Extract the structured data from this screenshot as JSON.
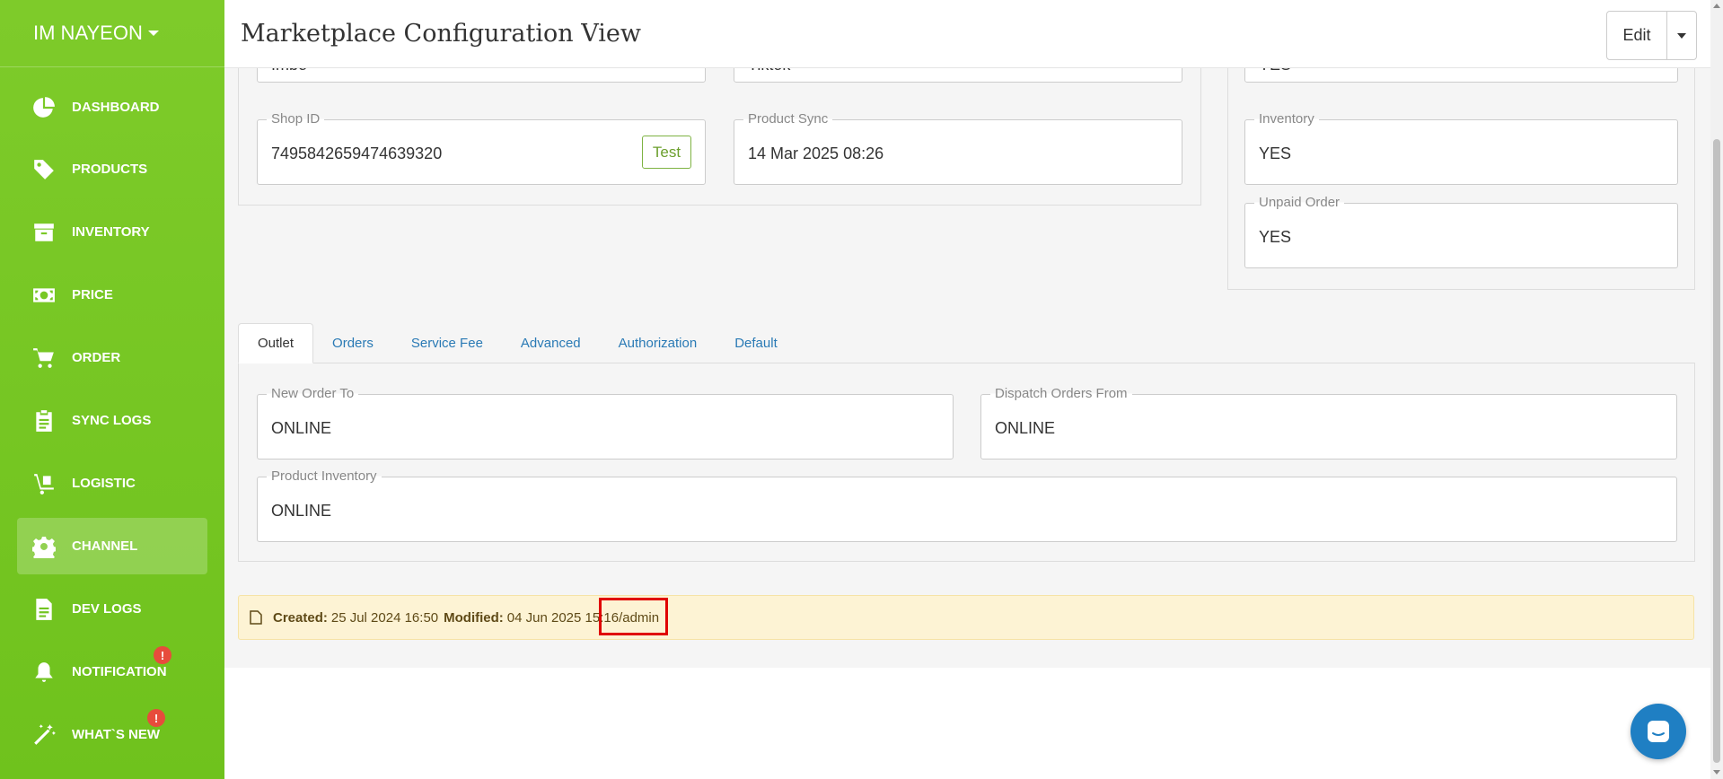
{
  "sidebar": {
    "brand": "IM NAYEON",
    "items": [
      {
        "label": "DASHBOARD",
        "icon": "pie-chart-icon"
      },
      {
        "label": "PRODUCTS",
        "icon": "tag-icon"
      },
      {
        "label": "INVENTORY",
        "icon": "archive-icon"
      },
      {
        "label": "PRICE",
        "icon": "money-icon"
      },
      {
        "label": "ORDER",
        "icon": "cart-icon"
      },
      {
        "label": "SYNC LOGS",
        "icon": "clipboard-icon"
      },
      {
        "label": "LOGISTIC",
        "icon": "dolly-icon"
      },
      {
        "label": "CHANNEL",
        "icon": "gear-icon",
        "active": true
      },
      {
        "label": "DEV LOGS",
        "icon": "file-icon"
      },
      {
        "label": "NOTIFICATION",
        "icon": "bell-icon",
        "badge": "!"
      },
      {
        "label": "WHAT`S NEW",
        "icon": "magic-wand-icon",
        "badge": "!"
      }
    ]
  },
  "header": {
    "title": "Marketplace Configuration View",
    "edit_label": "Edit"
  },
  "top_fields": {
    "name_clipped": "Imbe",
    "marketplace_clipped": "Tiktok",
    "right_clipped": "YES",
    "shop_id": {
      "label": "Shop ID",
      "value": "7495842659474639320",
      "button": "Test"
    },
    "product_sync": {
      "label": "Product Sync",
      "value": "14 Mar 2025 08:26"
    },
    "inventory": {
      "label": "Inventory",
      "value": "YES"
    },
    "unpaid_order": {
      "label": "Unpaid Order",
      "value": "YES"
    }
  },
  "tabs": [
    "Outlet",
    "Orders",
    "Service Fee",
    "Advanced",
    "Authorization",
    "Default"
  ],
  "outlet": {
    "new_order_to": {
      "label": "New Order To",
      "value": "ONLINE"
    },
    "dispatch_orders_from": {
      "label": "Dispatch Orders From",
      "value": "ONLINE"
    },
    "product_inventory": {
      "label": "Product Inventory",
      "value": "ONLINE"
    }
  },
  "info": {
    "created_label": "Created:",
    "created_value": "25 Jul 2024 16:50",
    "modified_label": "Modified:",
    "modified_value": "04 Jun 2025 15:16/admin"
  },
  "colors": {
    "sidebar": "#7ecb2a",
    "accent_blue": "#2a7ab5",
    "badge": "#e74c3c",
    "highlight": "#e00000"
  }
}
